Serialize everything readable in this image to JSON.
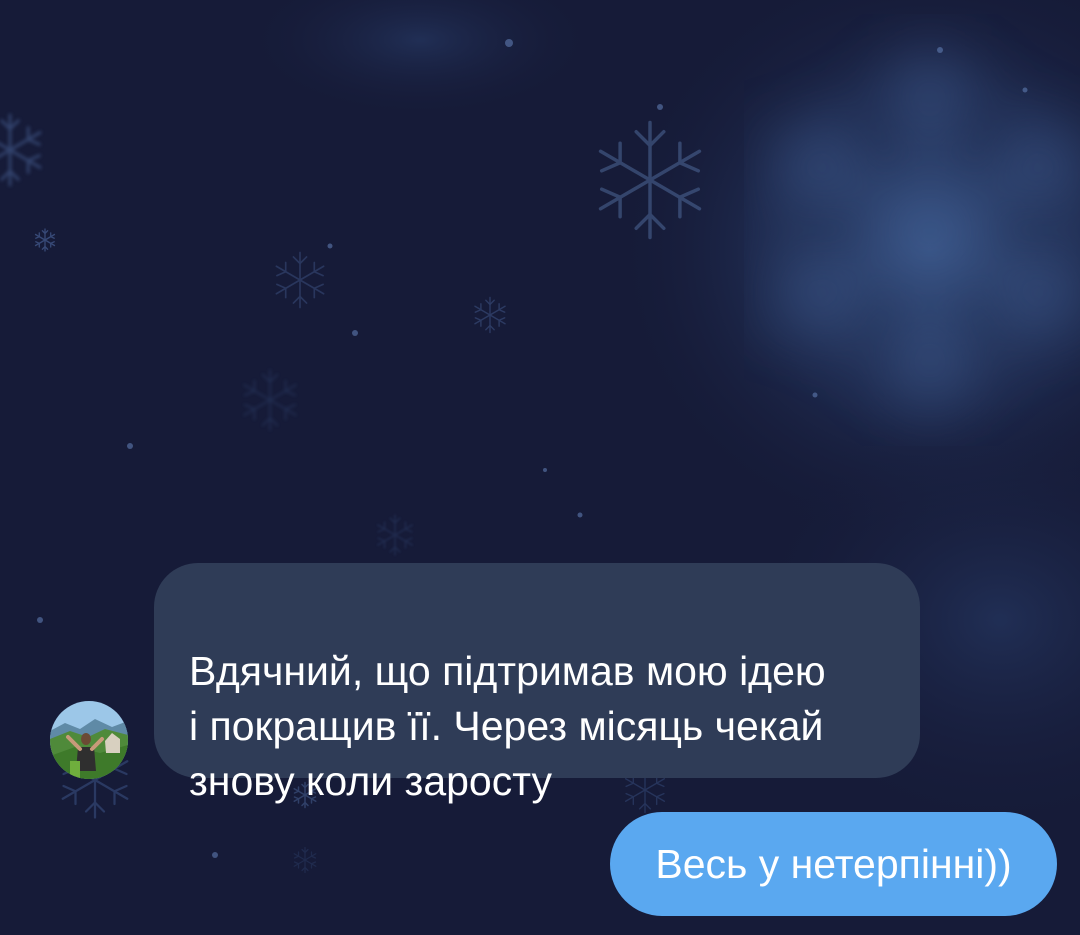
{
  "chat": {
    "background_color": "#161b38",
    "incoming_message": {
      "text": "Вдячний, що підтримав мою ідею\nі покращив її. Через місяць чекай\nзнову коли заросту",
      "bubble_color": "#2f3c57",
      "sender_avatar": "avatar-landscape-photo"
    },
    "outgoing_message": {
      "text": "Весь у нетерпінні))",
      "bubble_color": "#5aa8f0"
    }
  }
}
